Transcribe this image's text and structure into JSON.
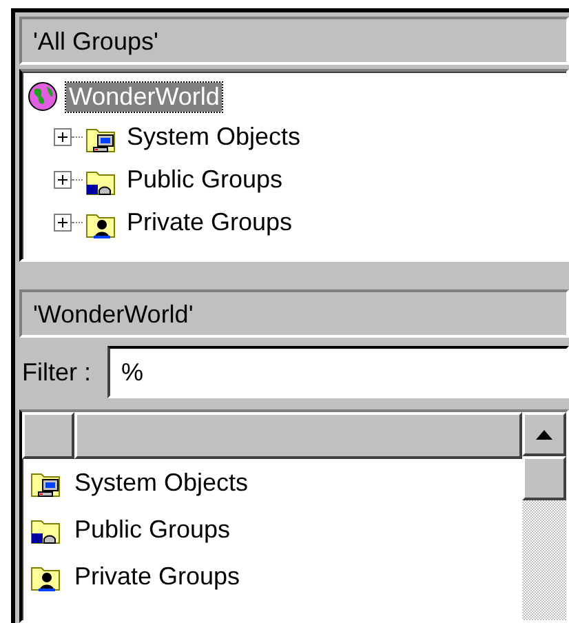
{
  "groups_header": "'All Groups'",
  "tree": {
    "label": "WonderWorld",
    "kind": "globe",
    "selected": true,
    "children": [
      {
        "label": "System Objects",
        "kind": "system",
        "expanded": false
      },
      {
        "label": "Public Groups",
        "kind": "public",
        "expanded": false
      },
      {
        "label": "Private Groups",
        "kind": "private",
        "expanded": false
      }
    ]
  },
  "detail_header": "'WonderWorld'",
  "filter": {
    "label": "Filter :",
    "value": "%"
  },
  "list": {
    "items": [
      {
        "label": "System Objects",
        "kind": "system"
      },
      {
        "label": "Public Groups",
        "kind": "public"
      },
      {
        "label": "Private Groups",
        "kind": "private"
      }
    ]
  }
}
